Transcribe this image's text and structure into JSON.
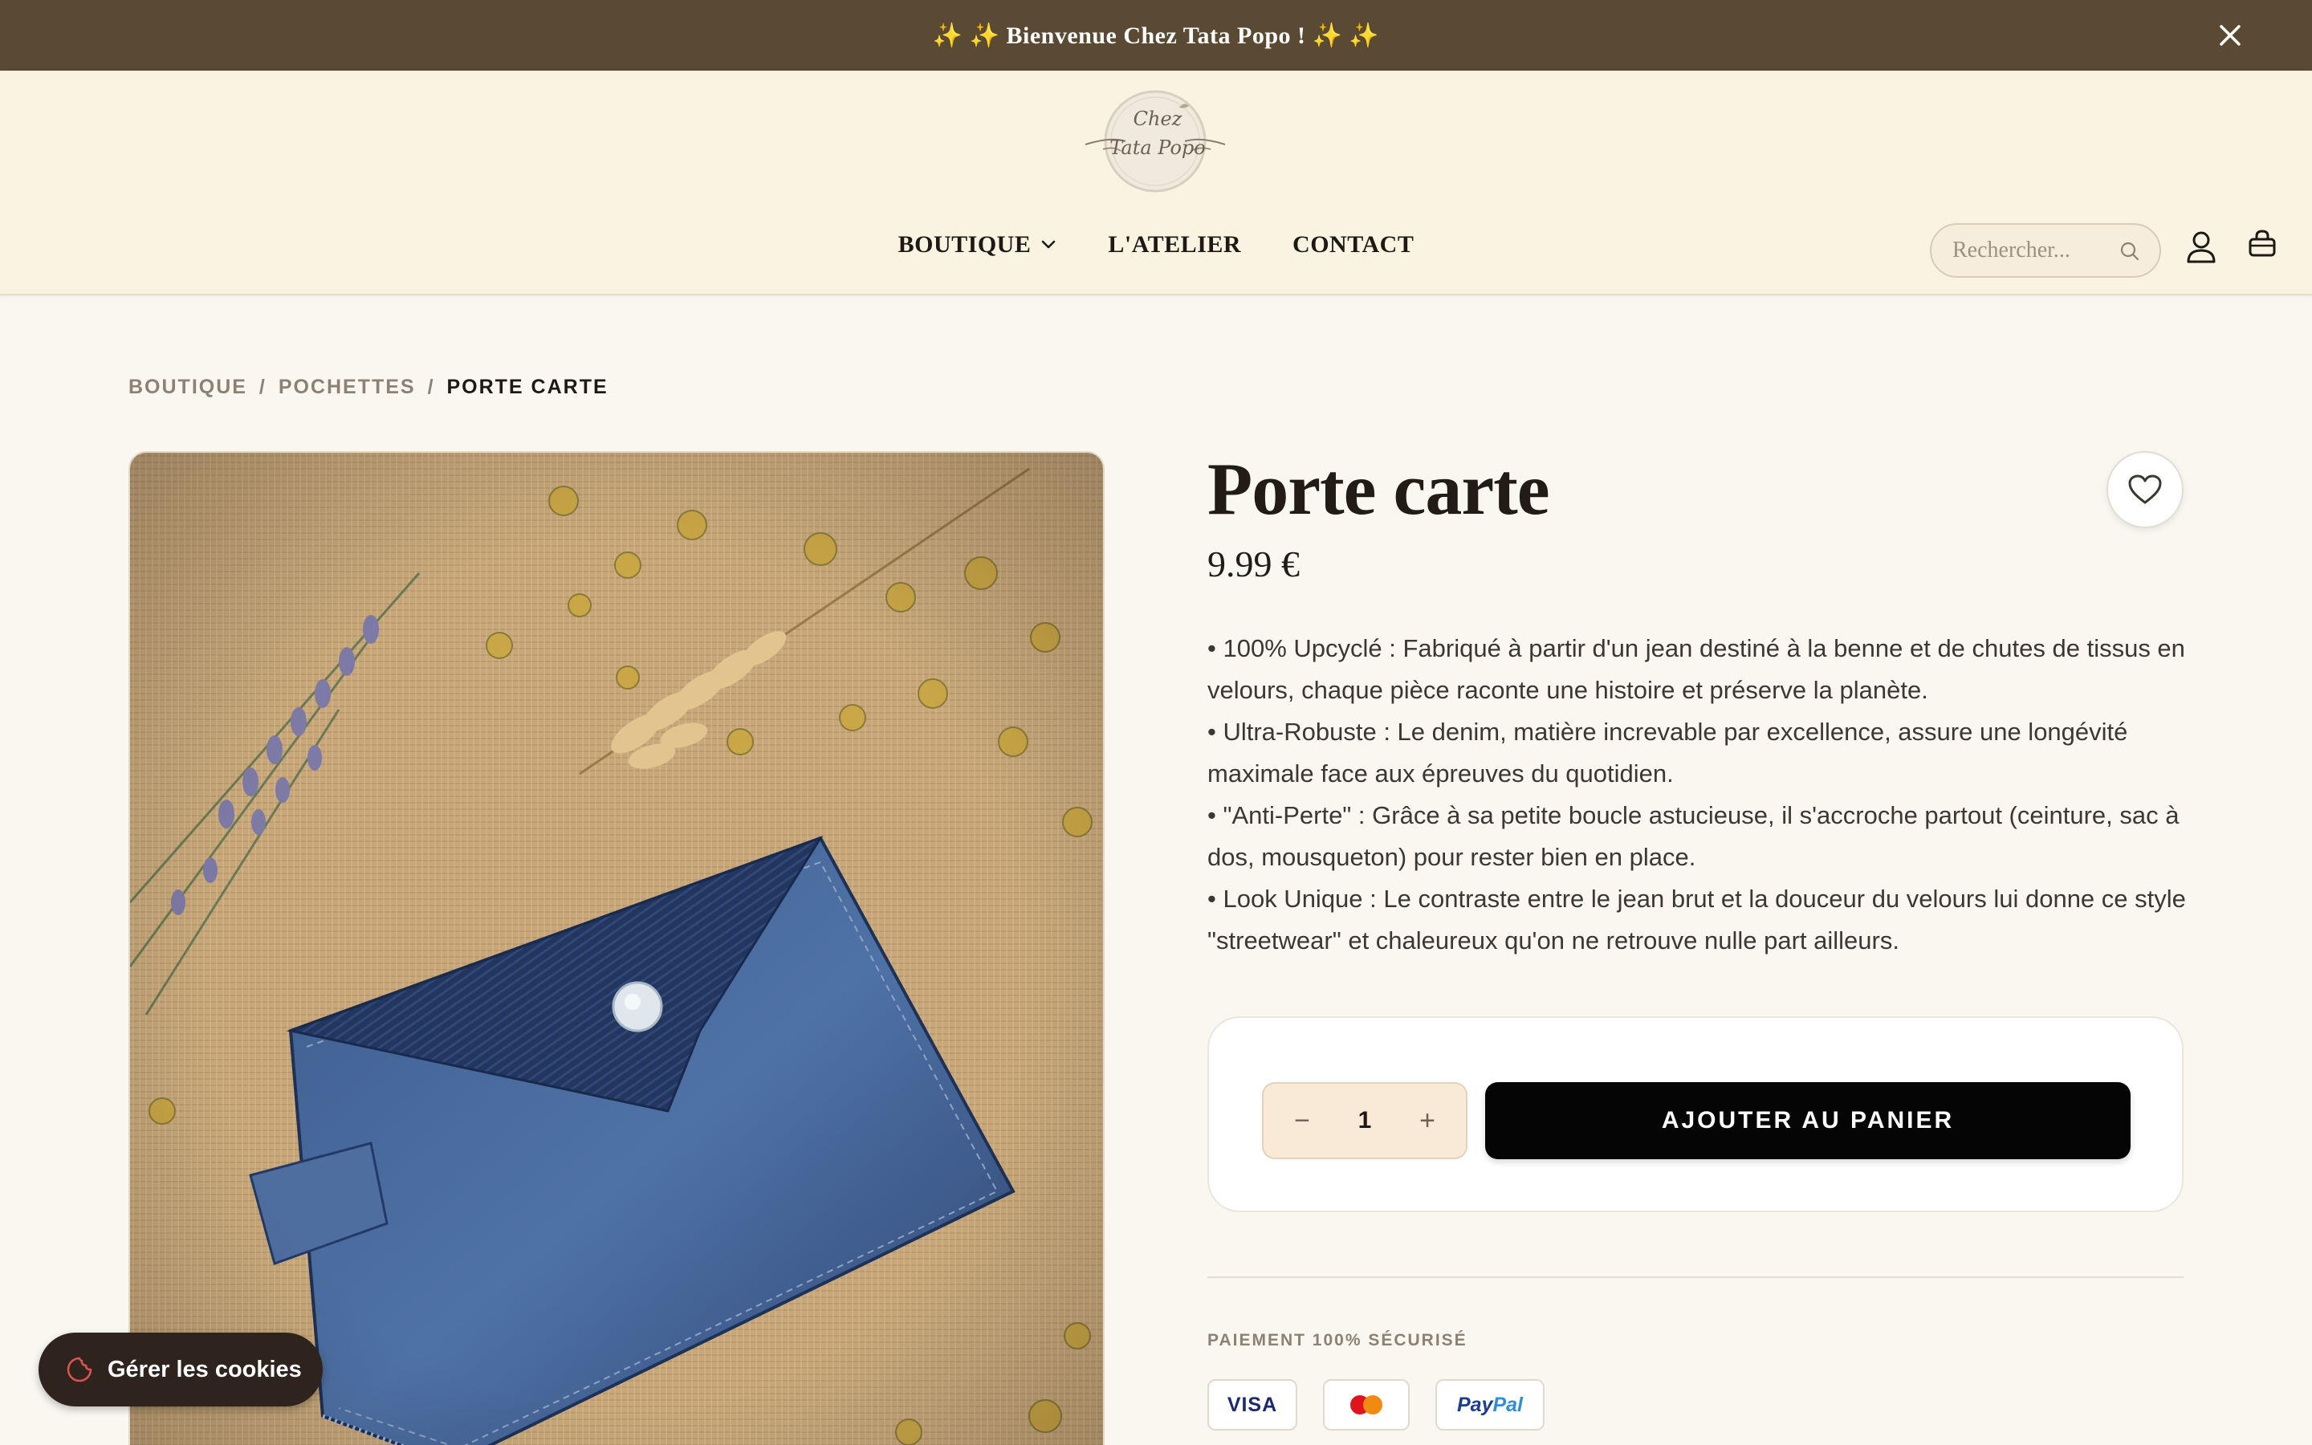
{
  "announcement": {
    "text": "✨  ✨ Bienvenue Chez Tata Popo ! ✨  ✨"
  },
  "logo": {
    "line1": "Chez",
    "line2": "Tata Popo"
  },
  "nav": {
    "items": [
      {
        "label": "BOUTIQUE",
        "has_dropdown": true
      },
      {
        "label": "L'ATELIER"
      },
      {
        "label": "CONTACT"
      }
    ]
  },
  "search": {
    "placeholder": "Rechercher..."
  },
  "breadcrumb": {
    "items": [
      "BOUTIQUE",
      "POCHETTES"
    ],
    "separator": "/",
    "current": "PORTE CARTE"
  },
  "product": {
    "title": "Porte carte",
    "price": "9.99 €",
    "description": [
      "• 100% Upcyclé : Fabriqué à partir d'un jean destiné à la benne et de chutes de tissus en velours, chaque pièce raconte une histoire et préserve la planète.",
      "• Ultra-Robuste : Le denim, matière increvable par excellence, assure une longévité maximale face aux épreuves du quotidien.",
      "• \"Anti-Perte\" : Grâce à sa petite boucle astucieuse, il s'accroche partout (ceinture, sac à dos, mousqueton) pour rester bien en place.",
      "• Look Unique : Le contraste entre le jean brut et la douceur du velours lui donne ce style \"streetwear\" et chaleureux qu'on ne retrouve nulle part ailleurs."
    ]
  },
  "purchase": {
    "decrement": "−",
    "quantity": "1",
    "increment": "+",
    "add_label": "AJOUTER AU PANIER"
  },
  "payment": {
    "heading": "PAIEMENT 100% SÉCURISÉ",
    "visa": "VISA",
    "paypal_a": "Pay",
    "paypal_b": "Pal"
  },
  "cookies": {
    "label": "Gérer les cookies"
  },
  "colors": {
    "announcement_bg": "#5b4a33",
    "header_bg": "#fbf3e2",
    "page_bg": "#faf7f1",
    "button_bg": "#050505",
    "cookie_bg": "#2e231d"
  }
}
